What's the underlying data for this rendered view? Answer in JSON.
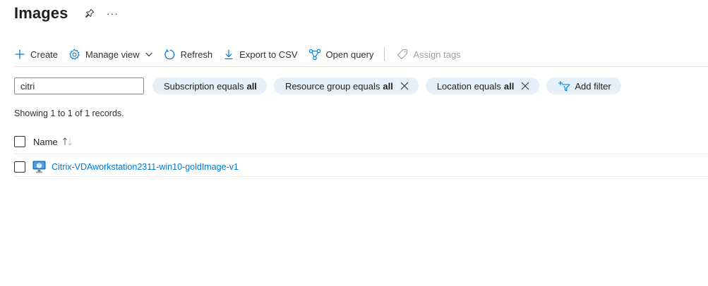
{
  "header": {
    "title": "Images",
    "pin_icon": "pin-icon",
    "more_icon": "more-icon",
    "more_glyph": "···"
  },
  "toolbar": {
    "create": "Create",
    "manage_view": "Manage view",
    "refresh": "Refresh",
    "export_csv": "Export to CSV",
    "open_query": "Open query",
    "assign_tags": "Assign tags"
  },
  "filters": {
    "search_value": "citri",
    "subscription": {
      "label": "Subscription equals",
      "value": "all"
    },
    "resource_group": {
      "label": "Resource group equals",
      "value": "all"
    },
    "location": {
      "label": "Location equals",
      "value": "all"
    },
    "add_filter": "Add filter"
  },
  "records_text": "Showing 1 to 1 of 1 records.",
  "grid": {
    "columns": [
      "Name"
    ],
    "rows": [
      {
        "name": "Citrix-VDAworkstation2311-win10-goldImage-v1"
      }
    ]
  },
  "colors": {
    "accent": "#0078d4",
    "pill_bg": "#e5f0fa",
    "disabled": "#a19f9d"
  }
}
